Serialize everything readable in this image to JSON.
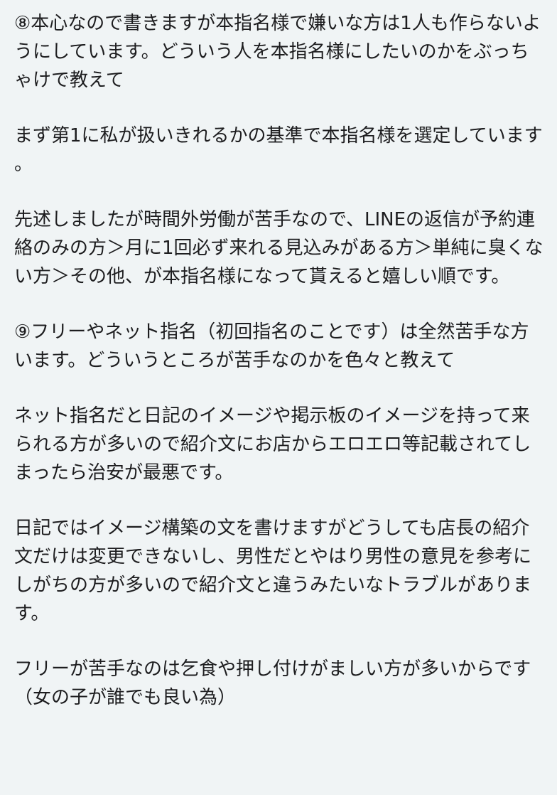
{
  "article": {
    "paragraphs": [
      "⑧本心なので書きますが本指名様で嫌いな方は1人も作らないようにしています。どういう人を本指名様にしたいのかをぶっちゃけで教えて",
      "まず第1に私が扱いきれるかの基準で本指名様を選定しています。",
      "先述しましたが時間外労働が苦手なので、LINEの返信が予約連絡のみの方＞月に1回必ず来れる見込みがある方＞単純に臭くない方＞その他、が本指名様になって貰えると嬉しい順です。",
      "⑨フリーやネット指名（初回指名のことです）は全然苦手な方います。どういうところが苦手なのかを色々と教えて",
      "ネット指名だと日記のイメージや掲示板のイメージを持って来られる方が多いので紹介文にお店からエロエロ等記載されてしまったら治安が最悪です。",
      "日記ではイメージ構築の文を書けますがどうしても店長の紹介文だけは変更できないし、男性だとやはり男性の意見を参考にしがちの方が多いので紹介文と違うみたいなトラブルがあります。",
      "フリーが苦手なのは乞食や押し付けがましい方が多いからです（女の子が誰でも良い為）"
    ]
  }
}
